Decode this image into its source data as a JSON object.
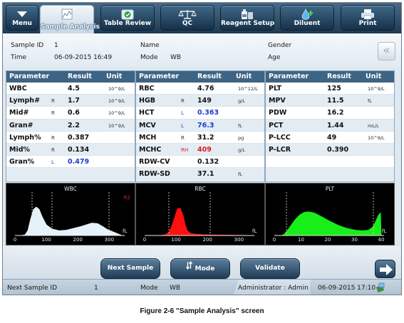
{
  "toolbar": {
    "buttons": [
      {
        "label": "Menu",
        "icon": "menu-triangle-icon",
        "active": false
      },
      {
        "label": "Sample Analysis",
        "icon": "chart-icon",
        "active": true
      },
      {
        "label": "Table Review",
        "icon": "table-review-icon",
        "active": false
      },
      {
        "label": "QC",
        "icon": "scale-icon",
        "active": false
      },
      {
        "label": "Reagent Setup",
        "icon": "reagent-bottle-icon",
        "active": false
      },
      {
        "label": "Diluent",
        "icon": "diluent-drop-icon",
        "active": false
      },
      {
        "label": "Print",
        "icon": "printer-icon",
        "active": false
      }
    ]
  },
  "info": {
    "sample_id_label": "Sample ID",
    "sample_id_value": "1",
    "time_label": "Time",
    "time_value": "06-09-2015 16:49",
    "name_label": "Name",
    "name_value": "",
    "mode_label": "Mode",
    "mode_value": "WB",
    "gender_label": "Gender",
    "gender_value": "",
    "age_label": "Age",
    "age_value": "",
    "back_glyph": "«"
  },
  "tables": [
    {
      "headers": [
        "Parameter",
        "Result",
        "Unit"
      ],
      "rows": [
        {
          "name": "WBC",
          "flag": "",
          "value": "4.5",
          "unit": "10^9/L",
          "status": "normal"
        },
        {
          "name": "Lymph#",
          "flag": "R",
          "value": "1.7",
          "unit": "10^9/L",
          "status": "normal"
        },
        {
          "name": "Mid#",
          "flag": "R",
          "value": "0.6",
          "unit": "10^9/L",
          "status": "normal"
        },
        {
          "name": "Gran#",
          "flag": "",
          "value": "2.2",
          "unit": "10^9/L",
          "status": "normal"
        },
        {
          "name": "Lymph%",
          "flag": "R",
          "value": "0.387",
          "unit": "",
          "status": "normal"
        },
        {
          "name": "Mid%",
          "flag": "R",
          "value": "0.134",
          "unit": "",
          "status": "normal"
        },
        {
          "name": "Gran%",
          "flag": "L",
          "value": "0.479",
          "unit": "",
          "status": "low"
        },
        {
          "name": "",
          "flag": "",
          "value": "",
          "unit": "",
          "status": "normal"
        }
      ]
    },
    {
      "headers": [
        "Parameter",
        "Result",
        "Unit"
      ],
      "rows": [
        {
          "name": "RBC",
          "flag": "",
          "value": "4.76",
          "unit": "10^12/L",
          "status": "normal"
        },
        {
          "name": "HGB",
          "flag": "R",
          "value": "149",
          "unit": "g/L",
          "status": "normal"
        },
        {
          "name": "HCT",
          "flag": "L",
          "value": "0.363",
          "unit": "",
          "status": "low"
        },
        {
          "name": "MCV",
          "flag": "L",
          "value": "76.3",
          "unit": "fL",
          "status": "low"
        },
        {
          "name": "MCH",
          "flag": "R",
          "value": "31.2",
          "unit": "pg",
          "status": "normal"
        },
        {
          "name": "MCHC",
          "flag": "RH",
          "value": "409",
          "unit": "g/L",
          "status": "high"
        },
        {
          "name": "RDW-CV",
          "flag": "",
          "value": "0.132",
          "unit": "",
          "status": "normal"
        },
        {
          "name": "RDW-SD",
          "flag": "",
          "value": "37.1",
          "unit": "fL",
          "status": "normal"
        }
      ]
    },
    {
      "headers": [
        "Parameter",
        "Result",
        "Unit"
      ],
      "rows": [
        {
          "name": "PLT",
          "flag": "",
          "value": "125",
          "unit": "10^9/L",
          "status": "normal"
        },
        {
          "name": "MPV",
          "flag": "",
          "value": "11.5",
          "unit": "fL",
          "status": "normal"
        },
        {
          "name": "PDW",
          "flag": "",
          "value": "16.2",
          "unit": "",
          "status": "normal"
        },
        {
          "name": "PCT",
          "flag": "",
          "value": "1.44",
          "unit": "mL/L",
          "status": "normal"
        },
        {
          "name": "P-LCC",
          "flag": "",
          "value": "49",
          "unit": "10^9/L",
          "status": "normal"
        },
        {
          "name": "P-LCR",
          "flag": "",
          "value": "0.390",
          "unit": "",
          "status": "normal"
        },
        {
          "name": "",
          "flag": "",
          "value": "",
          "unit": "",
          "status": "normal"
        },
        {
          "name": "",
          "flag": "",
          "value": "",
          "unit": "",
          "status": "normal"
        }
      ]
    }
  ],
  "histograms": [
    {
      "title": "WBC",
      "marker": "R2",
      "unit": "fL",
      "ticks": [
        "0",
        "100",
        "200",
        "300"
      ],
      "fill": "#e6f2fa"
    },
    {
      "title": "RBC",
      "marker": "",
      "unit": "fL",
      "ticks": [
        "0",
        "100",
        "200",
        "300"
      ],
      "fill": "#ff1010"
    },
    {
      "title": "PLT",
      "marker": "",
      "unit": "fL",
      "ticks": [
        "0",
        "10",
        "20",
        "30",
        "40"
      ],
      "fill": "#18ee18"
    }
  ],
  "actions": {
    "next_sample": "Next Sample",
    "mode": "Mode",
    "validate": "Validate"
  },
  "status_bar": {
    "next_sample_label": "Next Sample ID",
    "next_sample_value": "1",
    "mode_label": "Mode",
    "mode_value": "WB",
    "user": "Administrator : Admin",
    "datetime": "06-09-2015 17:10"
  },
  "caption": "Figure 2-6 \"Sample Analysis\" screen",
  "colors": {
    "low_flag": "#1b3bd6",
    "high_flag": "#e01b1b",
    "header_bg": "#3e6485"
  }
}
